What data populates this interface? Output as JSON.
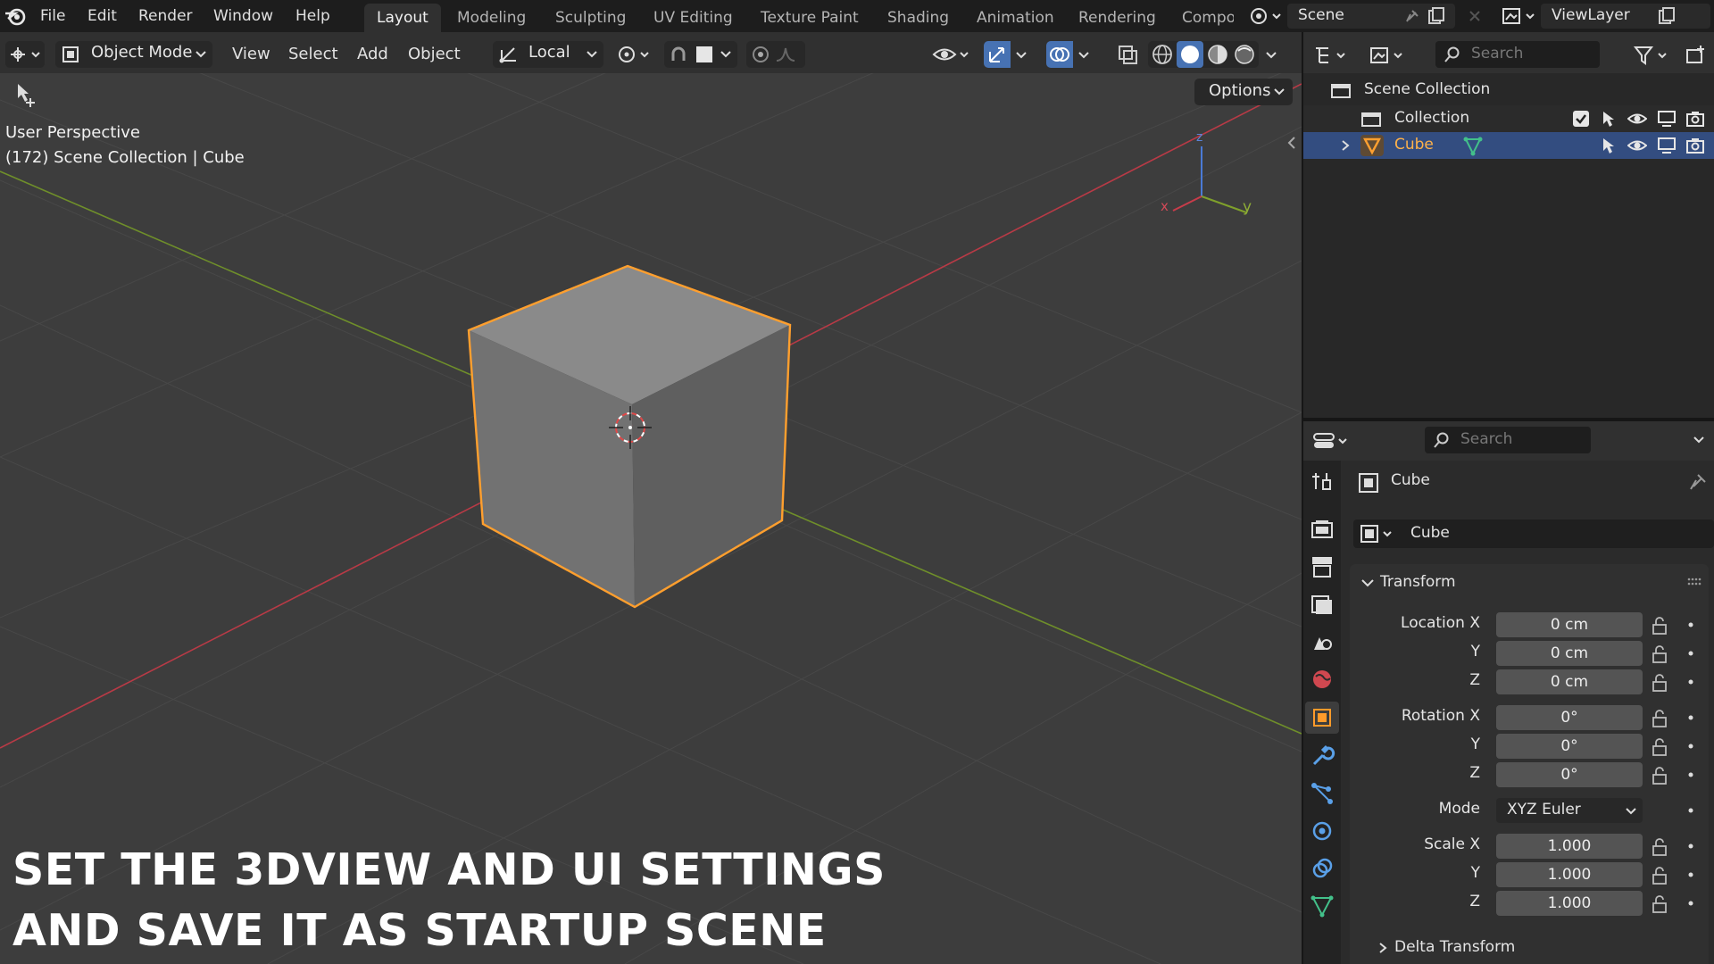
{
  "menu": {
    "items": [
      "File",
      "Edit",
      "Render",
      "Window",
      "Help"
    ]
  },
  "workspaces": {
    "tabs": [
      "Layout",
      "Modeling",
      "Sculpting",
      "UV Editing",
      "Texture Paint",
      "Shading",
      "Animation",
      "Rendering",
      "Compo"
    ],
    "active": "Layout"
  },
  "scene": {
    "name": "Scene",
    "view_layer": "ViewLayer"
  },
  "viewport_header": {
    "mode": "Object Mode",
    "menus": [
      "View",
      "Select",
      "Add",
      "Object"
    ],
    "orientation": "Local",
    "options": "Options"
  },
  "viewport": {
    "perspective": "User Perspective",
    "context": "(172) Scene Collection | Cube",
    "axis_x": "x",
    "axis_y": "y",
    "axis_z": "z"
  },
  "overlay_text": {
    "line1": "SET THE 3DVIEW AND UI SETTINGS",
    "line2": "AND SAVE IT AS STARTUP SCENE"
  },
  "outliner": {
    "search_placeholder": "Search",
    "root": "Scene Collection",
    "collection": "Collection",
    "object": "Cube"
  },
  "properties": {
    "search_placeholder": "Search",
    "object_title": "Cube",
    "object_name": "Cube",
    "transform_header": "Transform",
    "location": {
      "label": "Location X",
      "x": "0 cm",
      "y": "0 cm",
      "z": "0 cm"
    },
    "rotation": {
      "label": "Rotation X",
      "x": "0°",
      "y": "0°",
      "z": "0°"
    },
    "mode": {
      "label": "Mode",
      "value": "XYZ Euler"
    },
    "scale": {
      "label": "Scale X",
      "x": "1.000",
      "y": "1.000",
      "z": "1.000"
    },
    "axis_labels": {
      "y": "Y",
      "z": "Z"
    },
    "delta_header": "Delta Transform"
  },
  "colors": {
    "accent_blue": "#4772b3",
    "selection_orange": "#ffa030",
    "x_axis": "#c83c4a",
    "y_axis": "#7fa02b",
    "z_axis": "#4a7ad6"
  }
}
